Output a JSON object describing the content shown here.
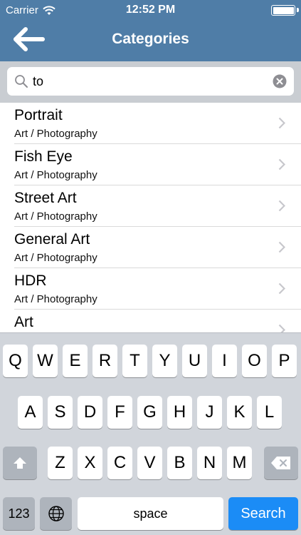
{
  "status_bar": {
    "carrier": "Carrier",
    "time": "12:52 PM",
    "battery_level": 1.0
  },
  "nav": {
    "title": "Categories",
    "back_icon": "arrow-left-icon"
  },
  "search": {
    "value": "to",
    "placeholder": "",
    "icon": "search-icon",
    "clear_icon": "clear-icon"
  },
  "results": [
    {
      "title": "Portrait",
      "subtitle": "Art / Photography"
    },
    {
      "title": "Fish Eye",
      "subtitle": "Art / Photography"
    },
    {
      "title": "Street Art",
      "subtitle": "Art / Photography"
    },
    {
      "title": "General Art",
      "subtitle": "Art / Photography"
    },
    {
      "title": "HDR",
      "subtitle": "Art / Photography"
    },
    {
      "title": "Art",
      "subtitle": ""
    }
  ],
  "keyboard": {
    "row1": [
      "Q",
      "W",
      "E",
      "R",
      "T",
      "Y",
      "U",
      "I",
      "O",
      "P"
    ],
    "row2": [
      "A",
      "S",
      "D",
      "F",
      "G",
      "H",
      "J",
      "K",
      "L"
    ],
    "row3": [
      "Z",
      "X",
      "C",
      "V",
      "B",
      "N",
      "M"
    ],
    "numbers_label": "123",
    "space_label": "space",
    "search_label": "Search",
    "shift_icon": "shift-icon",
    "delete_icon": "backspace-icon",
    "globe_icon": "globe-icon"
  },
  "colors": {
    "nav_background": "#4f7da7",
    "search_key": "#1b8cf6"
  }
}
